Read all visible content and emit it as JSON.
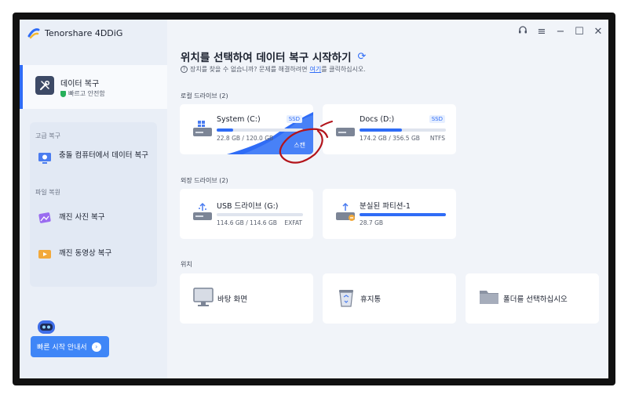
{
  "app": {
    "name": "Tenorshare 4DDiG"
  },
  "sidebar": {
    "active": {
      "title": "데이터 복구",
      "subtitle": "빠르고 안전함"
    },
    "advanced_label": "고급 복구",
    "crash_item": "충돌 컴퓨터에서 데이터 복구",
    "file_repair_label": "파일 복원",
    "photo_item": "깨진 사진 복구",
    "video_item": "깨진 동영상 복구",
    "guide_button": "빠른 시작 안내서"
  },
  "main": {
    "title": "위치를 선택하여 데이터 복구 시작하기",
    "help_prefix": "장치를 찾을 수 없습니까? 문제를 해결하려면",
    "help_link": "여기",
    "help_suffix": "를 클릭하십시오.",
    "local_label": "로컬 드라이브 (2)",
    "external_label": "외장 드라이브 (2)",
    "location_label": "위치"
  },
  "local_drives": [
    {
      "name": "System (C:)",
      "tag": "SSD",
      "size": "22.8 GB / 120.0 GB",
      "fs": "",
      "used_fraction": 0.19,
      "scan_label": "스캔"
    },
    {
      "name": "Docs (D:)",
      "tag": "SSD",
      "size": "174.2 GB / 356.5 GB",
      "fs": "NTFS",
      "used_fraction": 0.49
    }
  ],
  "external_drives": [
    {
      "name": "USB 드라이브 (G:)",
      "size": "114.6 GB / 114.6 GB",
      "fs": "EXFAT",
      "used_fraction": 0.0
    },
    {
      "name": "분실된 파티션-1",
      "size": "28.7 GB",
      "fs": "",
      "used_fraction": 1.0
    }
  ],
  "locations": [
    {
      "name": "바탕 화면",
      "icon": "monitor-icon"
    },
    {
      "name": "휴지통",
      "icon": "recycle-bin-icon"
    },
    {
      "name": "폴더를 선택하십시오",
      "icon": "folder-icon"
    }
  ],
  "window_controls": [
    "headset-icon",
    "menu-icon",
    "minimize-icon",
    "maximize-icon",
    "close-icon"
  ],
  "colors": {
    "accent": "#2f6cf6",
    "annotation": "#b3141b",
    "safe_green": "#26b05a"
  }
}
